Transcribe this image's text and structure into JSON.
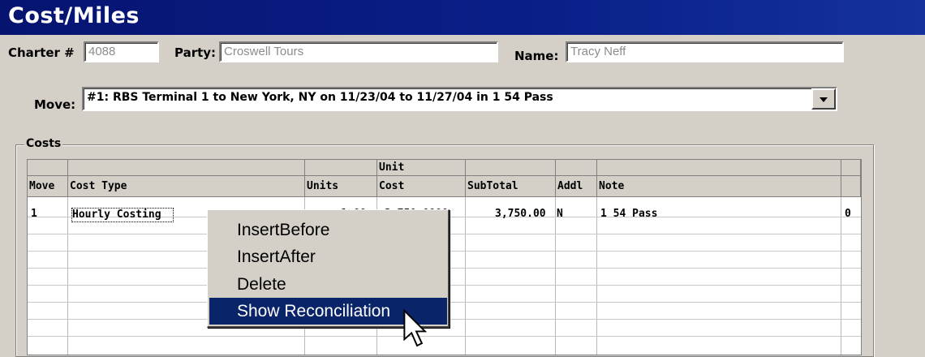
{
  "window": {
    "title": "Cost/Miles"
  },
  "form": {
    "charter_label": "Charter #",
    "charter_value": "4088",
    "party_label": "Party:",
    "party_value": "Croswell Tours",
    "name_label": "Name:",
    "name_value": "Tracy Neff",
    "move_label": "Move:",
    "move_value": "#1: RBS Terminal 1 to New York, NY on 11/23/04 to 11/27/04 in 1 54 Pass"
  },
  "costs": {
    "group_label": "Costs",
    "headers": {
      "move": "Move",
      "cost_type": "Cost Type",
      "units": "Units",
      "unit_line1": "Unit",
      "unit_line2": "Cost",
      "subtotal": "SubTotal",
      "addl": "Addl",
      "note": "Note"
    },
    "rows": [
      {
        "move": "1",
        "cost_type": "Hourly Costing",
        "units": "1.00",
        "unit_cost": "3,750.0000",
        "subtotal": "3,750.00",
        "addl": "N",
        "note": "1 54 Pass",
        "extra": "0"
      }
    ]
  },
  "context_menu": {
    "items": [
      "InsertBefore",
      "InsertAfter",
      "Delete",
      "Show Reconciliation"
    ],
    "selected_index": 3
  },
  "icons": [
    "dropdown-arrow-icon",
    "mouse-cursor-icon"
  ],
  "colors": {
    "title_bar": "#0a1f8a",
    "menu_highlight": "#0a246a",
    "window_bg": "#d4d0c8"
  }
}
